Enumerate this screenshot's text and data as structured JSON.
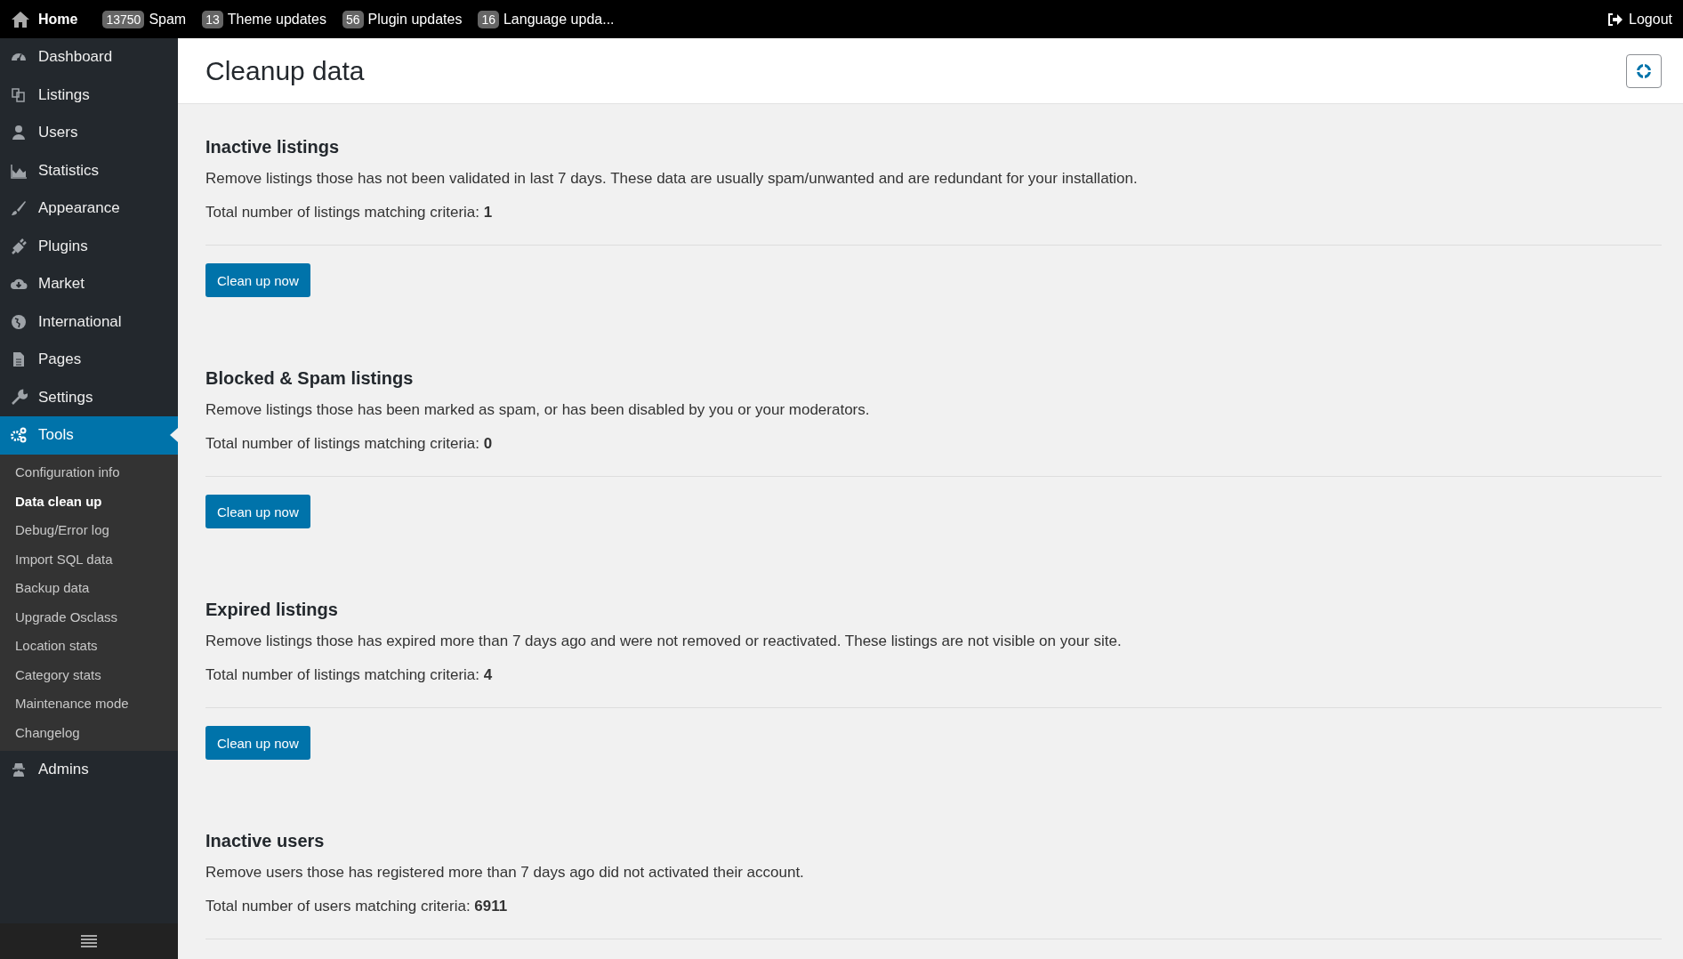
{
  "topbar": {
    "home": "Home",
    "items": [
      {
        "count": "13750",
        "label": "Spam"
      },
      {
        "count": "13",
        "label": "Theme updates"
      },
      {
        "count": "56",
        "label": "Plugin updates"
      },
      {
        "count": "16",
        "label": "Language upda..."
      }
    ],
    "logout": "Logout"
  },
  "sidebar": {
    "items": [
      {
        "label": "Dashboard",
        "selected": false
      },
      {
        "label": "Listings",
        "selected": false
      },
      {
        "label": "Users",
        "selected": false
      },
      {
        "label": "Statistics",
        "selected": false
      },
      {
        "label": "Appearance",
        "selected": false
      },
      {
        "label": "Plugins",
        "selected": false
      },
      {
        "label": "Market",
        "selected": false
      },
      {
        "label": "International",
        "selected": false
      },
      {
        "label": "Pages",
        "selected": false
      },
      {
        "label": "Settings",
        "selected": false
      },
      {
        "label": "Tools",
        "selected": true,
        "expanded": true,
        "children": [
          {
            "label": "Configuration info",
            "selected": false
          },
          {
            "label": "Data clean up",
            "selected": true
          },
          {
            "label": "Debug/Error log",
            "selected": false
          },
          {
            "label": "Import SQL data",
            "selected": false
          },
          {
            "label": "Backup data",
            "selected": false
          },
          {
            "label": "Upgrade Osclass",
            "selected": false
          },
          {
            "label": "Location stats",
            "selected": false
          },
          {
            "label": "Category stats",
            "selected": false
          },
          {
            "label": "Maintenance mode",
            "selected": false
          },
          {
            "label": "Changelog",
            "selected": false
          }
        ]
      },
      {
        "label": "Admins",
        "selected": false
      }
    ]
  },
  "page": {
    "title": "Cleanup data",
    "sections": [
      {
        "title": "Inactive listings",
        "description": "Remove listings those has not been validated in last 7 days. These data are usually spam/unwanted and are redundant for your installation.",
        "total": "Total number of listings matching criteria: **1**",
        "button": "Clean up now"
      },
      {
        "title": "Blocked & Spam listings",
        "description": "Remove listings those has been marked as spam, or has been disabled by you or your moderators.",
        "total": "Total number of listings matching criteria: **0**",
        "button": "Clean up now"
      },
      {
        "title": "Expired listings",
        "description": "Remove listings those has expired more than 7 days ago and were not removed or reactivated. These listings are not visible on your site.",
        "total": "Total number of listings matching criteria: **4**",
        "button": "Clean up now"
      },
      {
        "title": "Inactive users",
        "description": "Remove users those has registered more than 7 days ago did not activated their account.",
        "total": "Total number of users matching criteria: **6911**"
      }
    ]
  }
}
